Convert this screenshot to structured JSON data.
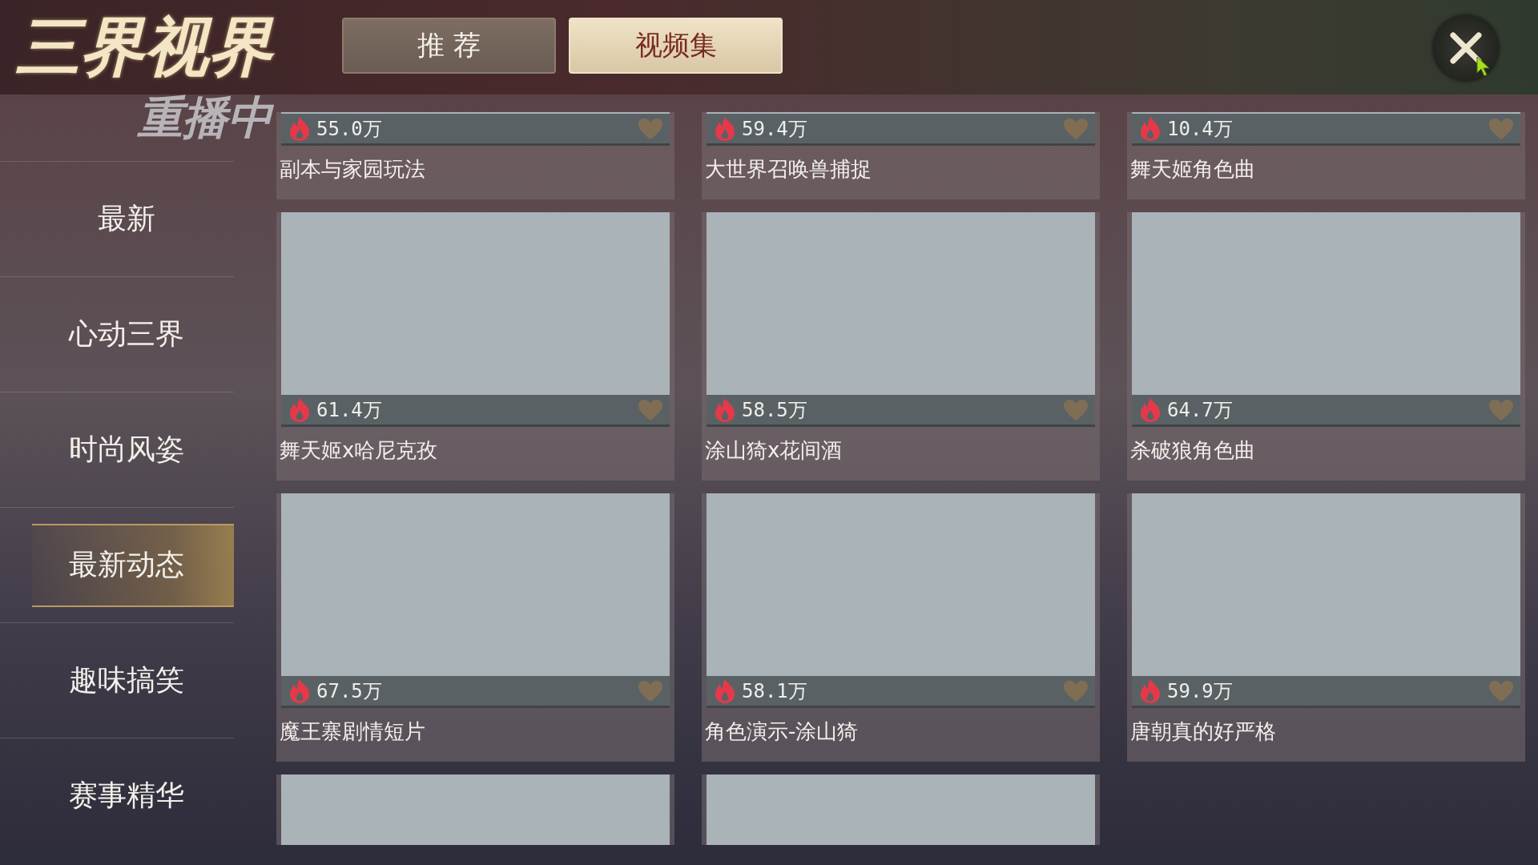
{
  "logo": {
    "title": "三界视界",
    "overlay": "重播中"
  },
  "tabs": [
    {
      "label": "推 荐",
      "selected": false
    },
    {
      "label": "视频集",
      "selected": true
    }
  ],
  "sidebar": {
    "items": [
      {
        "label": "最新",
        "selected": false
      },
      {
        "label": "心动三界",
        "selected": false
      },
      {
        "label": "时尚风姿",
        "selected": false
      },
      {
        "label": "最新动态",
        "selected": true
      },
      {
        "label": "趣味搞笑",
        "selected": false
      },
      {
        "label": "赛事精华",
        "selected": false
      }
    ]
  },
  "cards": [
    {
      "kind": "full",
      "views": "55.0万",
      "title": "副本与家园玩法"
    },
    {
      "kind": "full",
      "views": "59.4万",
      "title": "大世界召唤兽捕捉"
    },
    {
      "kind": "full",
      "views": "10.4万",
      "title": "舞天姬角色曲"
    },
    {
      "kind": "full",
      "views": "61.4万",
      "title": "舞天姬x哈尼克孜"
    },
    {
      "kind": "full",
      "views": "58.5万",
      "title": "涂山猗x花间酒"
    },
    {
      "kind": "full",
      "views": "64.7万",
      "title": "杀破狼角色曲"
    },
    {
      "kind": "full",
      "views": "67.5万",
      "title": "魔王寨剧情短片"
    },
    {
      "kind": "full",
      "views": "58.1万",
      "title": "角色演示-涂山猗"
    },
    {
      "kind": "full",
      "views": "59.9万",
      "title": "唐朝真的好严格"
    },
    {
      "kind": "thumbnail_only"
    },
    {
      "kind": "thumbnail_only"
    }
  ]
}
